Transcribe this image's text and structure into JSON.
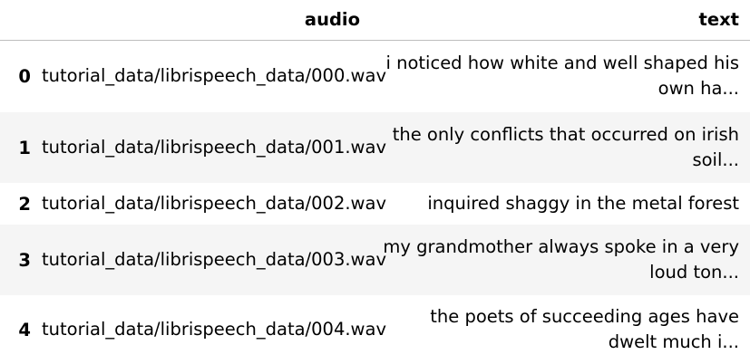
{
  "table": {
    "columns": [
      "",
      "audio",
      "text"
    ],
    "rows": [
      {
        "index": "0",
        "audio": "tutorial_data/librispeech_data/000.wav",
        "text": "i noticed how white and well shaped his own ha..."
      },
      {
        "index": "1",
        "audio": "tutorial_data/librispeech_data/001.wav",
        "text": "the only conflicts that occurred on irish soil..."
      },
      {
        "index": "2",
        "audio": "tutorial_data/librispeech_data/002.wav",
        "text": "inquired shaggy in the metal forest"
      },
      {
        "index": "3",
        "audio": "tutorial_data/librispeech_data/003.wav",
        "text": "my grandmother always spoke in a very loud ton..."
      },
      {
        "index": "4",
        "audio": "tutorial_data/librispeech_data/004.wav",
        "text": "the poets of succeeding ages have dwelt much i..."
      }
    ]
  }
}
